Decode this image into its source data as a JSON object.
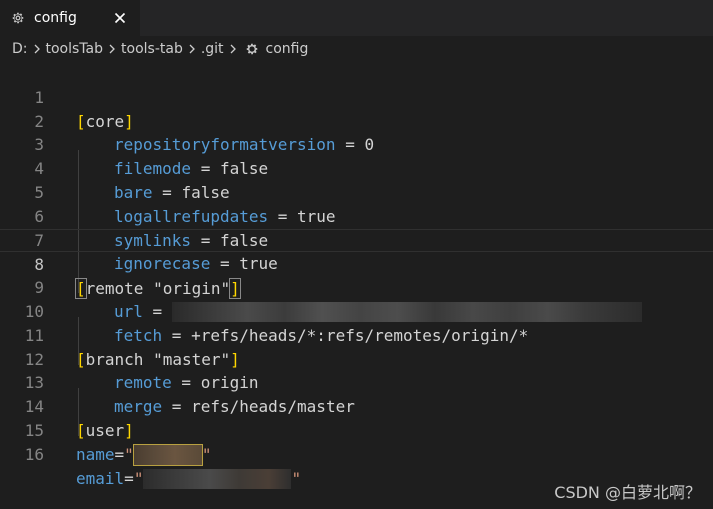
{
  "tab": {
    "label": "config",
    "icon": "gear-icon",
    "close_icon": "close-icon"
  },
  "breadcrumb": {
    "items": [
      "D:",
      "toolsTab",
      "tools-tab",
      ".git",
      "config"
    ]
  },
  "colors": {
    "background": "#1e1e1e",
    "tabbar": "#252526",
    "key": "#569cd6",
    "bracket": "#ffd700",
    "string": "#ce9178",
    "text": "#d4d4d4",
    "line_number": "#858585"
  },
  "editor": {
    "lines": [
      {
        "n": "1",
        "section": "core"
      },
      {
        "n": "2",
        "key": "repositoryformatversion",
        "value": "0"
      },
      {
        "n": "3",
        "key": "filemode",
        "value": "false"
      },
      {
        "n": "4",
        "key": "bare",
        "value": "false"
      },
      {
        "n": "5",
        "key": "logallrefupdates",
        "value": "true"
      },
      {
        "n": "6",
        "key": "symlinks",
        "value": "false"
      },
      {
        "n": "7",
        "key": "ignorecase",
        "value": "true"
      },
      {
        "n": "8",
        "section": "remote \"origin\""
      },
      {
        "n": "9",
        "key": "url",
        "value": ""
      },
      {
        "n": "10",
        "key": "fetch",
        "value": "+refs/heads/*:refs/remotes/origin/*"
      },
      {
        "n": "11",
        "section": "branch \"master\""
      },
      {
        "n": "12",
        "key": "remote",
        "value": "origin"
      },
      {
        "n": "13",
        "key": "merge",
        "value": "refs/heads/master"
      },
      {
        "n": "14",
        "section": "user"
      },
      {
        "n": "15",
        "plainkey": "name",
        "quoted": true
      },
      {
        "n": "16",
        "plainkey": "email",
        "quoted": true
      }
    ],
    "current_line": "8"
  },
  "watermark": "CSDN @白萝北啊？"
}
